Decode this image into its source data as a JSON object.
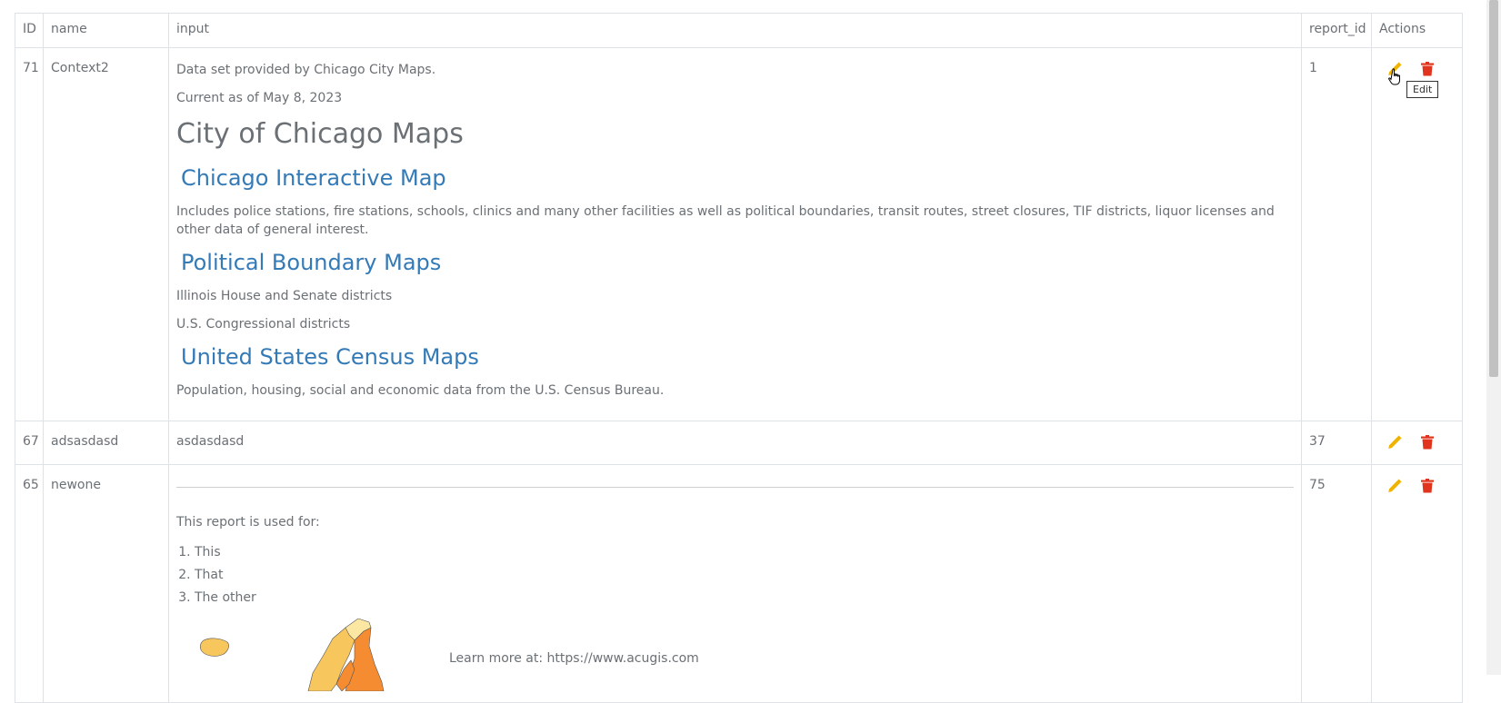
{
  "table": {
    "headers": {
      "id": "ID",
      "name": "name",
      "input": "input",
      "report_id": "report_id",
      "actions": "Actions"
    },
    "rows": [
      {
        "id": "71",
        "name": "Context2",
        "report_id": "1",
        "input": {
          "p1": "Data set provided by Chicago City Maps.",
          "p2": "Current as of May 8, 2023",
          "title": "City of Chicago Maps",
          "link1": "Chicago Interactive Map",
          "desc1": "Includes police stations, fire stations, schools, clinics and many other facilities as well as political boundaries, transit routes, street closures, TIF districts, liquor licenses and other data of general interest.",
          "link2": "Political Boundary Maps",
          "desc2a": "Illinois House and Senate districts",
          "desc2b": "U.S. Congressional districts",
          "link3": "United States Census Maps",
          "desc3": "Population, housing, social and economic data from the U.S. Census Bureau."
        },
        "tooltip": "Edit"
      },
      {
        "id": "67",
        "name": "adsasdasd",
        "report_id": "37",
        "input": "asdasdasd"
      },
      {
        "id": "65",
        "name": "newone",
        "report_id": "75",
        "input": {
          "intro": "This report is used for:",
          "items": [
            "This",
            "That",
            "The other"
          ],
          "learn_more": "Learn more at: https://www.acugis.com"
        }
      }
    ]
  },
  "icons": {
    "edit": "pencil-icon",
    "delete": "trash-icon"
  },
  "colors": {
    "edit": "#f0b400",
    "delete": "#e0341e",
    "link": "#337ab7",
    "map_light": "#f7c65d",
    "map_dark": "#f58c32"
  }
}
